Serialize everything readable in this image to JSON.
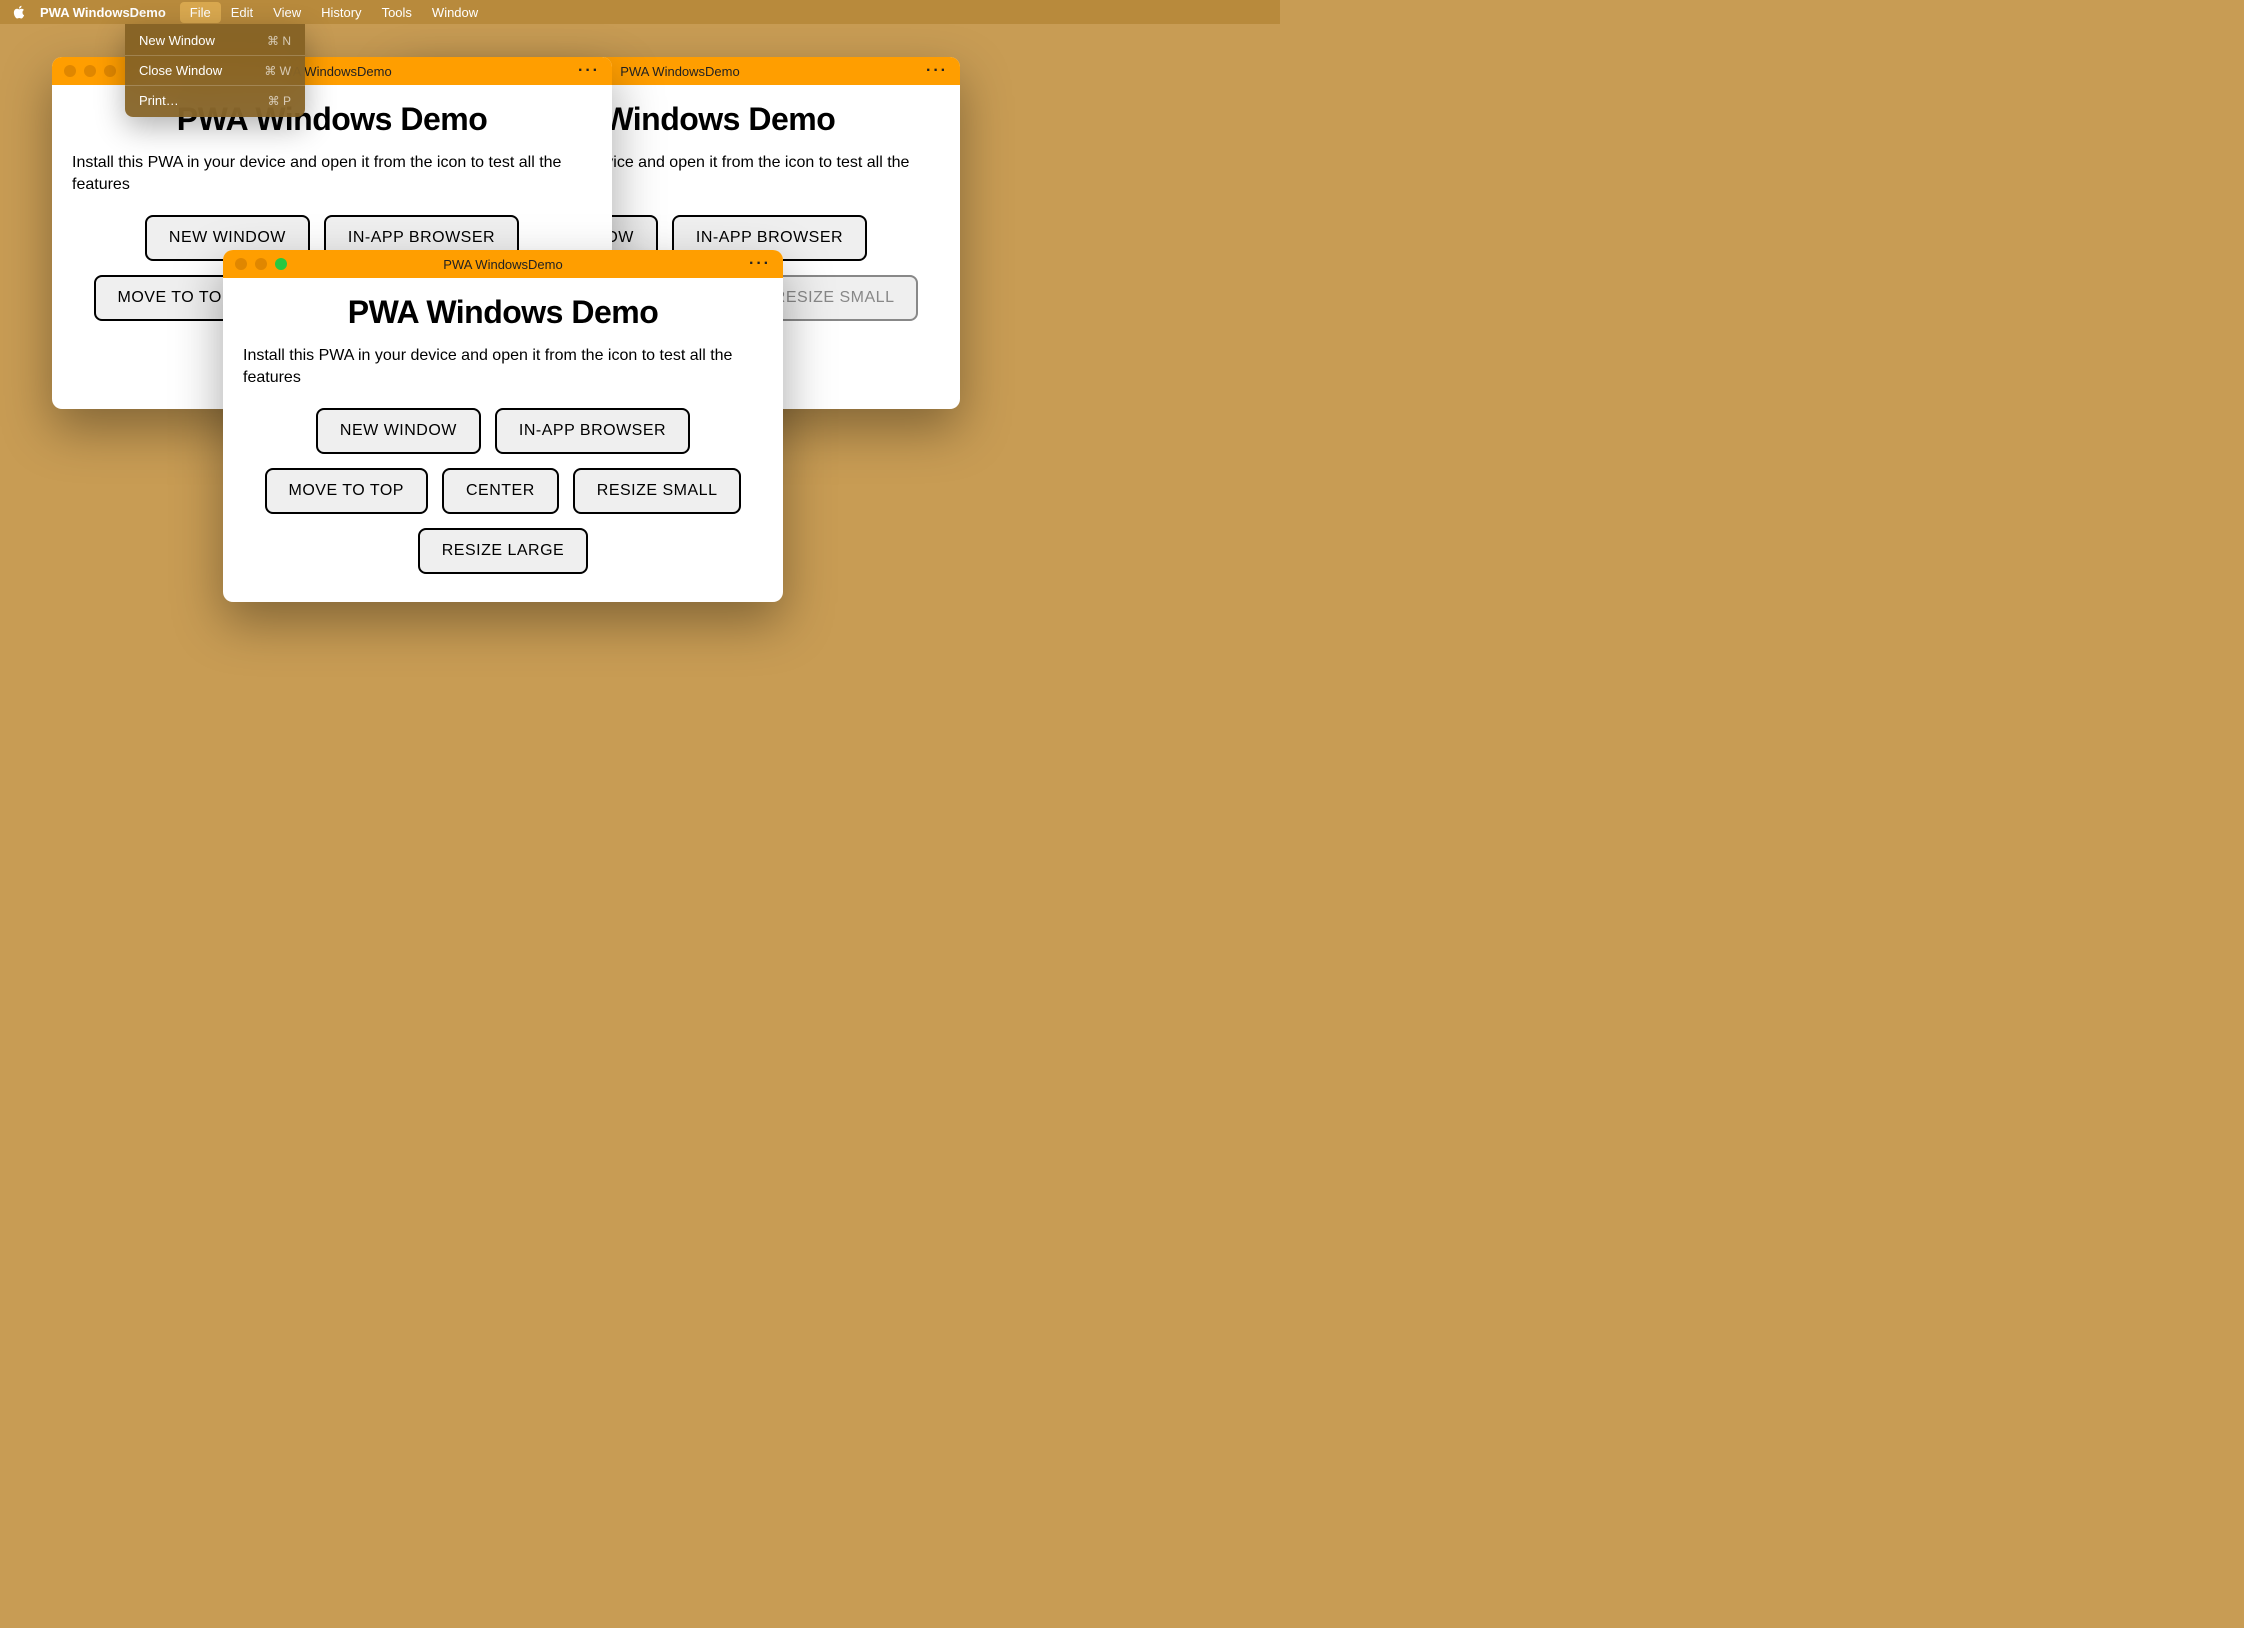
{
  "menubar": {
    "app_name": "PWA WindowsDemo",
    "items": [
      "File",
      "Edit",
      "View",
      "History",
      "Tools",
      "Window"
    ],
    "active_index": 0
  },
  "dropdown": {
    "items": [
      {
        "label": "New Window",
        "shortcut": "⌘ N"
      },
      {
        "label": "Close Window",
        "shortcut": "⌘ W"
      },
      {
        "label": "Print…",
        "shortcut": "⌘ P"
      }
    ]
  },
  "app": {
    "window_title": "PWA WindowsDemo",
    "heading": "PWA Windows Demo",
    "description": "Install this PWA in your device and open it from the icon to test all the features",
    "buttons": {
      "new_window": "NEW WINDOW",
      "in_app_browser": "IN-APP BROWSER",
      "move_to_top": "MOVE TO TOP",
      "center": "CENTER",
      "resize_small": "RESIZE SMALL",
      "resize_large": "RESIZE LARGE"
    }
  }
}
